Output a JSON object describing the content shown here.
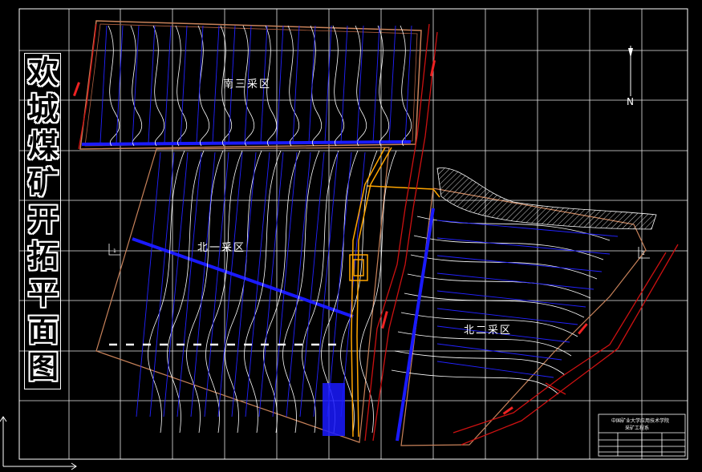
{
  "drawing": {
    "title_chars": [
      "欢",
      "城",
      "煤",
      "矿",
      "开",
      "拓",
      "平",
      "面",
      "图"
    ],
    "zones": {
      "south_three": "南三采区",
      "north_one": "北一采区",
      "north_two": "北二采区"
    },
    "north_arrow": "N",
    "section_marks": [
      "1",
      "1"
    ],
    "title_block": {
      "line1": "中国矿业大学应用技术学院",
      "line2": "采矿工程系"
    },
    "colors": {
      "background": "#000000",
      "grid": "#ffffff",
      "contour": "#ffffff",
      "roadway_blue": "#1a1aff",
      "boundary": "#c8825a",
      "fault_red": "#cc1111",
      "shaft_orange": "#ffa500"
    }
  }
}
